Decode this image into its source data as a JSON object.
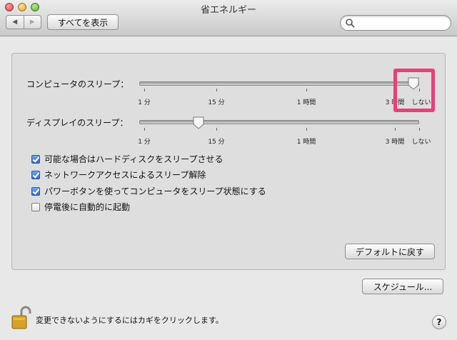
{
  "window": {
    "title": "省エネルギー"
  },
  "toolbar": {
    "back_icon": "◀",
    "forward_icon": "▶",
    "show_all_label": "すべてを表示",
    "search_placeholder": ""
  },
  "computer_sleep": {
    "label": "コンピュータのスリープ：",
    "ticks": [
      "1 分",
      "15 分",
      "1 時間",
      "3 時間",
      "しない"
    ],
    "value": "しない"
  },
  "display_sleep": {
    "label": "ディスプレイのスリープ：",
    "ticks": [
      "1 分",
      "15 分",
      "1 時間",
      "3 時間",
      "しない"
    ],
    "value": "15 分"
  },
  "options": [
    {
      "label": "可能な場合はハードディスクをスリープさせる",
      "checked": true
    },
    {
      "label": "ネットワークアクセスによるスリープ解除",
      "checked": true
    },
    {
      "label": "パワーボタンを使ってコンピュータをスリープ状態にする",
      "checked": true
    },
    {
      "label": "停電後に自動的に起動",
      "checked": false
    }
  ],
  "buttons": {
    "restore_defaults": "デフォルトに戻す",
    "schedule": "スケジュール..."
  },
  "footer": {
    "lock_text": "変更できないようにするにはカギをクリックします。",
    "help_label": "?"
  },
  "colors": {
    "highlight": "#f03c7a",
    "checkbox_accent": "#2a6fd0"
  }
}
